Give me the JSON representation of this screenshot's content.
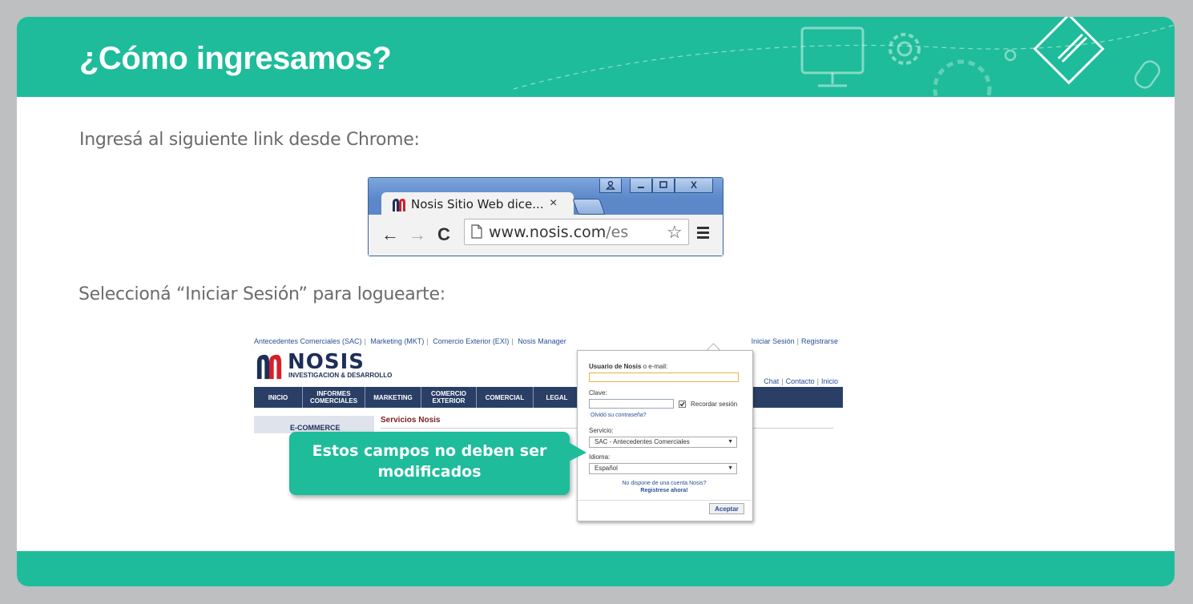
{
  "slide": {
    "title": "¿Cómo ingresamos?",
    "instruction_1": "Ingresá al siguiente link desde Chrome:",
    "instruction_2": "Seleccioná  “Iniciar Sesión” para loguearte:",
    "accent_color": "#1ebc9a"
  },
  "browser": {
    "tab_title": "Nosis Sitio Web dice...",
    "tab_close": "×",
    "url_host": "www.nosis.com",
    "url_path": "/es",
    "window_buttons": [
      "user",
      "minimize",
      "maximize",
      "close"
    ],
    "close_label": "X"
  },
  "site": {
    "top_links": [
      "Antecedentes Comerciales (SAC)",
      "Marketing (MKT)",
      "Comercio Exterior (EXI)",
      "Nosis Manager"
    ],
    "login_link": "Iniciar Sesión",
    "register_link": "Registrarse",
    "secondary_links": [
      "Chat",
      "Contacto",
      "Inicio"
    ],
    "logo_name": "NOSIS",
    "logo_tagline": "INVESTIGACION & DESARROLLO",
    "nav": [
      {
        "line1": "INICIO",
        "line2": ""
      },
      {
        "line1": "INFORMES",
        "line2": "COMERCIALES"
      },
      {
        "line1": "MARKETING",
        "line2": ""
      },
      {
        "line1": "COMERCIO",
        "line2": "EXTERIOR"
      },
      {
        "line1": "COMERCIAL",
        "line2": ""
      },
      {
        "line1": "LEGAL",
        "line2": ""
      }
    ],
    "sidebar_label": "E-COMMERCE",
    "section_title": "Servicios Nosis"
  },
  "login_form": {
    "user_label_bold": "Usuario de Nosis",
    "user_label_rest": " o e-mail:",
    "password_label": "Clave:",
    "remember_label": "Recordar sesión",
    "forgot_link": "Olvidó su contraseña?",
    "service_label": "Servicio:",
    "service_value": "SAC - Antecedentes Comerciales",
    "language_label": "Idioma:",
    "language_value": "Español",
    "no_account": "No dispone de una cuenta Nosis?",
    "register_now": "Registrese ahora!",
    "accept_button": "Aceptar"
  },
  "callout": {
    "text_line1": "Estos campos no deben ser",
    "text_line2": "modificados"
  }
}
